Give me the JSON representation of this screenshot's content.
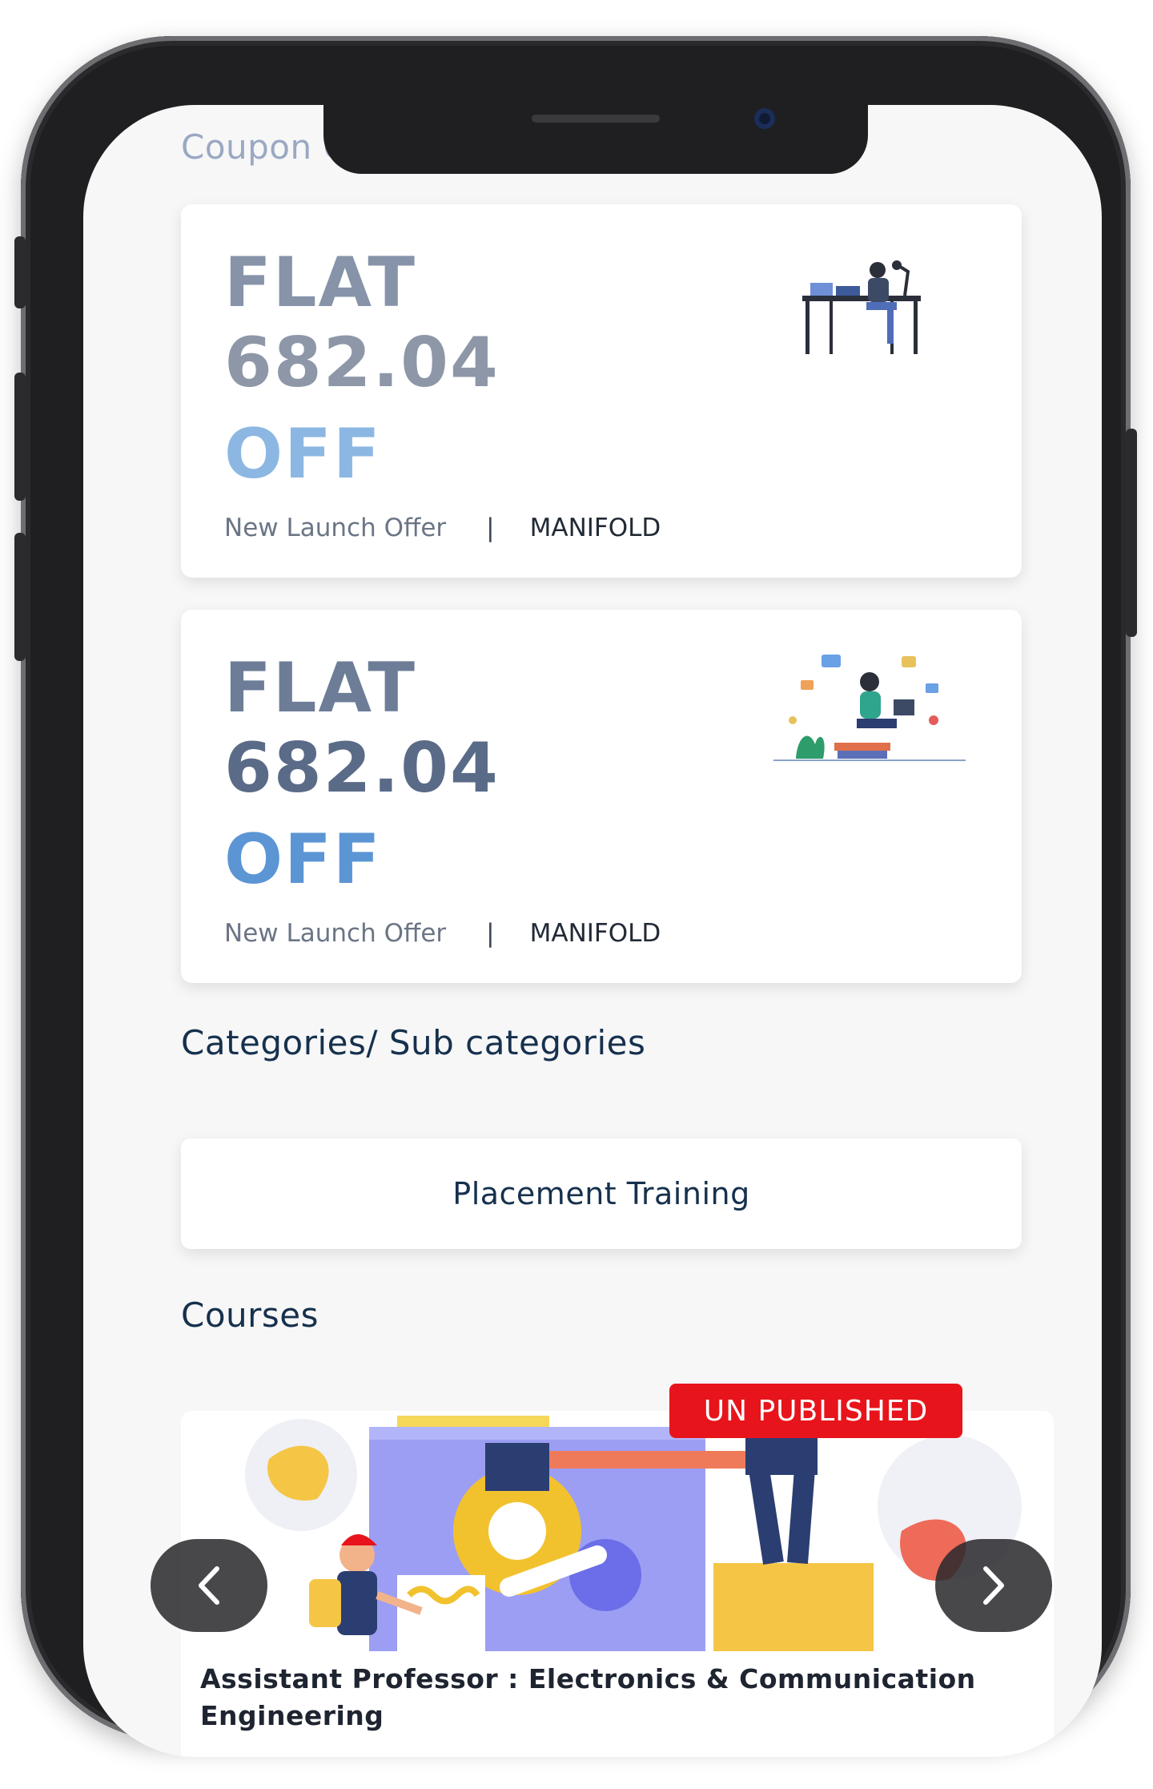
{
  "coupons": {
    "heading": "Coupon Codes",
    "items": [
      {
        "flat": "FLAT",
        "amount": "682.04",
        "off": "OFF",
        "offer": "New Launch Offer",
        "separator": "|",
        "brand": "MANIFOLD"
      },
      {
        "flat": "FLAT",
        "amount": "682.04",
        "off": "OFF",
        "offer": "New Launch Offer",
        "separator": "|",
        "brand": "MANIFOLD"
      }
    ]
  },
  "categories": {
    "heading": "Categories/ Sub categories",
    "items": [
      {
        "label": "Placement Training"
      }
    ]
  },
  "courses": {
    "heading": "Courses",
    "items": [
      {
        "badge": "UN PUBLISHED",
        "title": "Assistant Professor : Electronics & Communication Engineering"
      }
    ],
    "prev_icon": "chevron-left-icon",
    "next_icon": "chevron-right-icon"
  },
  "colors": {
    "badge": "#e8141b",
    "heading": "#16314d",
    "accent_blue": "#5b95d4"
  }
}
